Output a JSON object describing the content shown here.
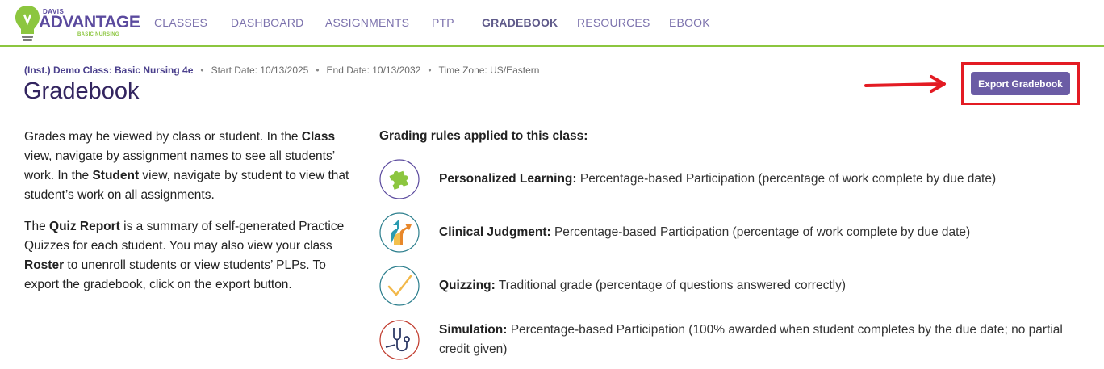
{
  "header": {
    "logo": {
      "brand_top": "DAVIS",
      "brand_main": "ADVANTAGE",
      "brand_sub": "BASIC NURSING"
    },
    "nav": [
      {
        "label": "CLASSES",
        "active": false
      },
      {
        "label": "DASHBOARD",
        "active": false
      },
      {
        "label": "ASSIGNMENTS",
        "active": false
      },
      {
        "label": "PTP",
        "active": false
      },
      {
        "label": "GRADEBOOK",
        "active": true
      },
      {
        "label": "RESOURCES",
        "active": false
      },
      {
        "label": "EBOOK",
        "active": false
      }
    ]
  },
  "class_info": {
    "class_name": "(Inst.) Demo Class: Basic Nursing 4e",
    "start_date": "Start Date: 10/13/2025",
    "end_date": "End Date: 10/13/2032",
    "time_zone": "Time Zone: US/Eastern"
  },
  "page_title": "Gradebook",
  "export_button_label": "Export Gradebook",
  "description": {
    "p1": [
      "Grades may be viewed by class or student. In the ",
      "Class",
      " view, navigate by assignment names to see all students’ work. In the ",
      "Student",
      " view, navigate by student to view that student’s work on all assignments."
    ],
    "p2": [
      "The ",
      "Quiz Report",
      " is a summary of self-generated Practice Quizzes for each student. You may also view your class ",
      "Roster",
      " to unenroll students or view students’ PLPs. To export the gradebook, click on the export button."
    ]
  },
  "rules_title": "Grading rules applied to this class:",
  "rules": [
    {
      "name": "Personalized Learning:",
      "text": " Percentage-based Participation (percentage of work complete by due date)",
      "icon": "puzzle-icon"
    },
    {
      "name": "Clinical Judgment:",
      "text": " Percentage-based Participation (percentage of work complete by due date)",
      "icon": "split-arrows-icon"
    },
    {
      "name": "Quizzing:",
      "text": " Traditional grade (percentage of questions answered correctly)",
      "icon": "checkmark-icon"
    },
    {
      "name": "Simulation:",
      "text": " Percentage-based Participation (100% awarded when student completes by the due date; no partial credit given)",
      "icon": "stethoscope-icon"
    }
  ],
  "colors": {
    "brand_purple": "#5b4a9e",
    "brand_green": "#8cc63f",
    "button_purple": "#6b5ca5",
    "highlight_red": "#e31b23"
  }
}
